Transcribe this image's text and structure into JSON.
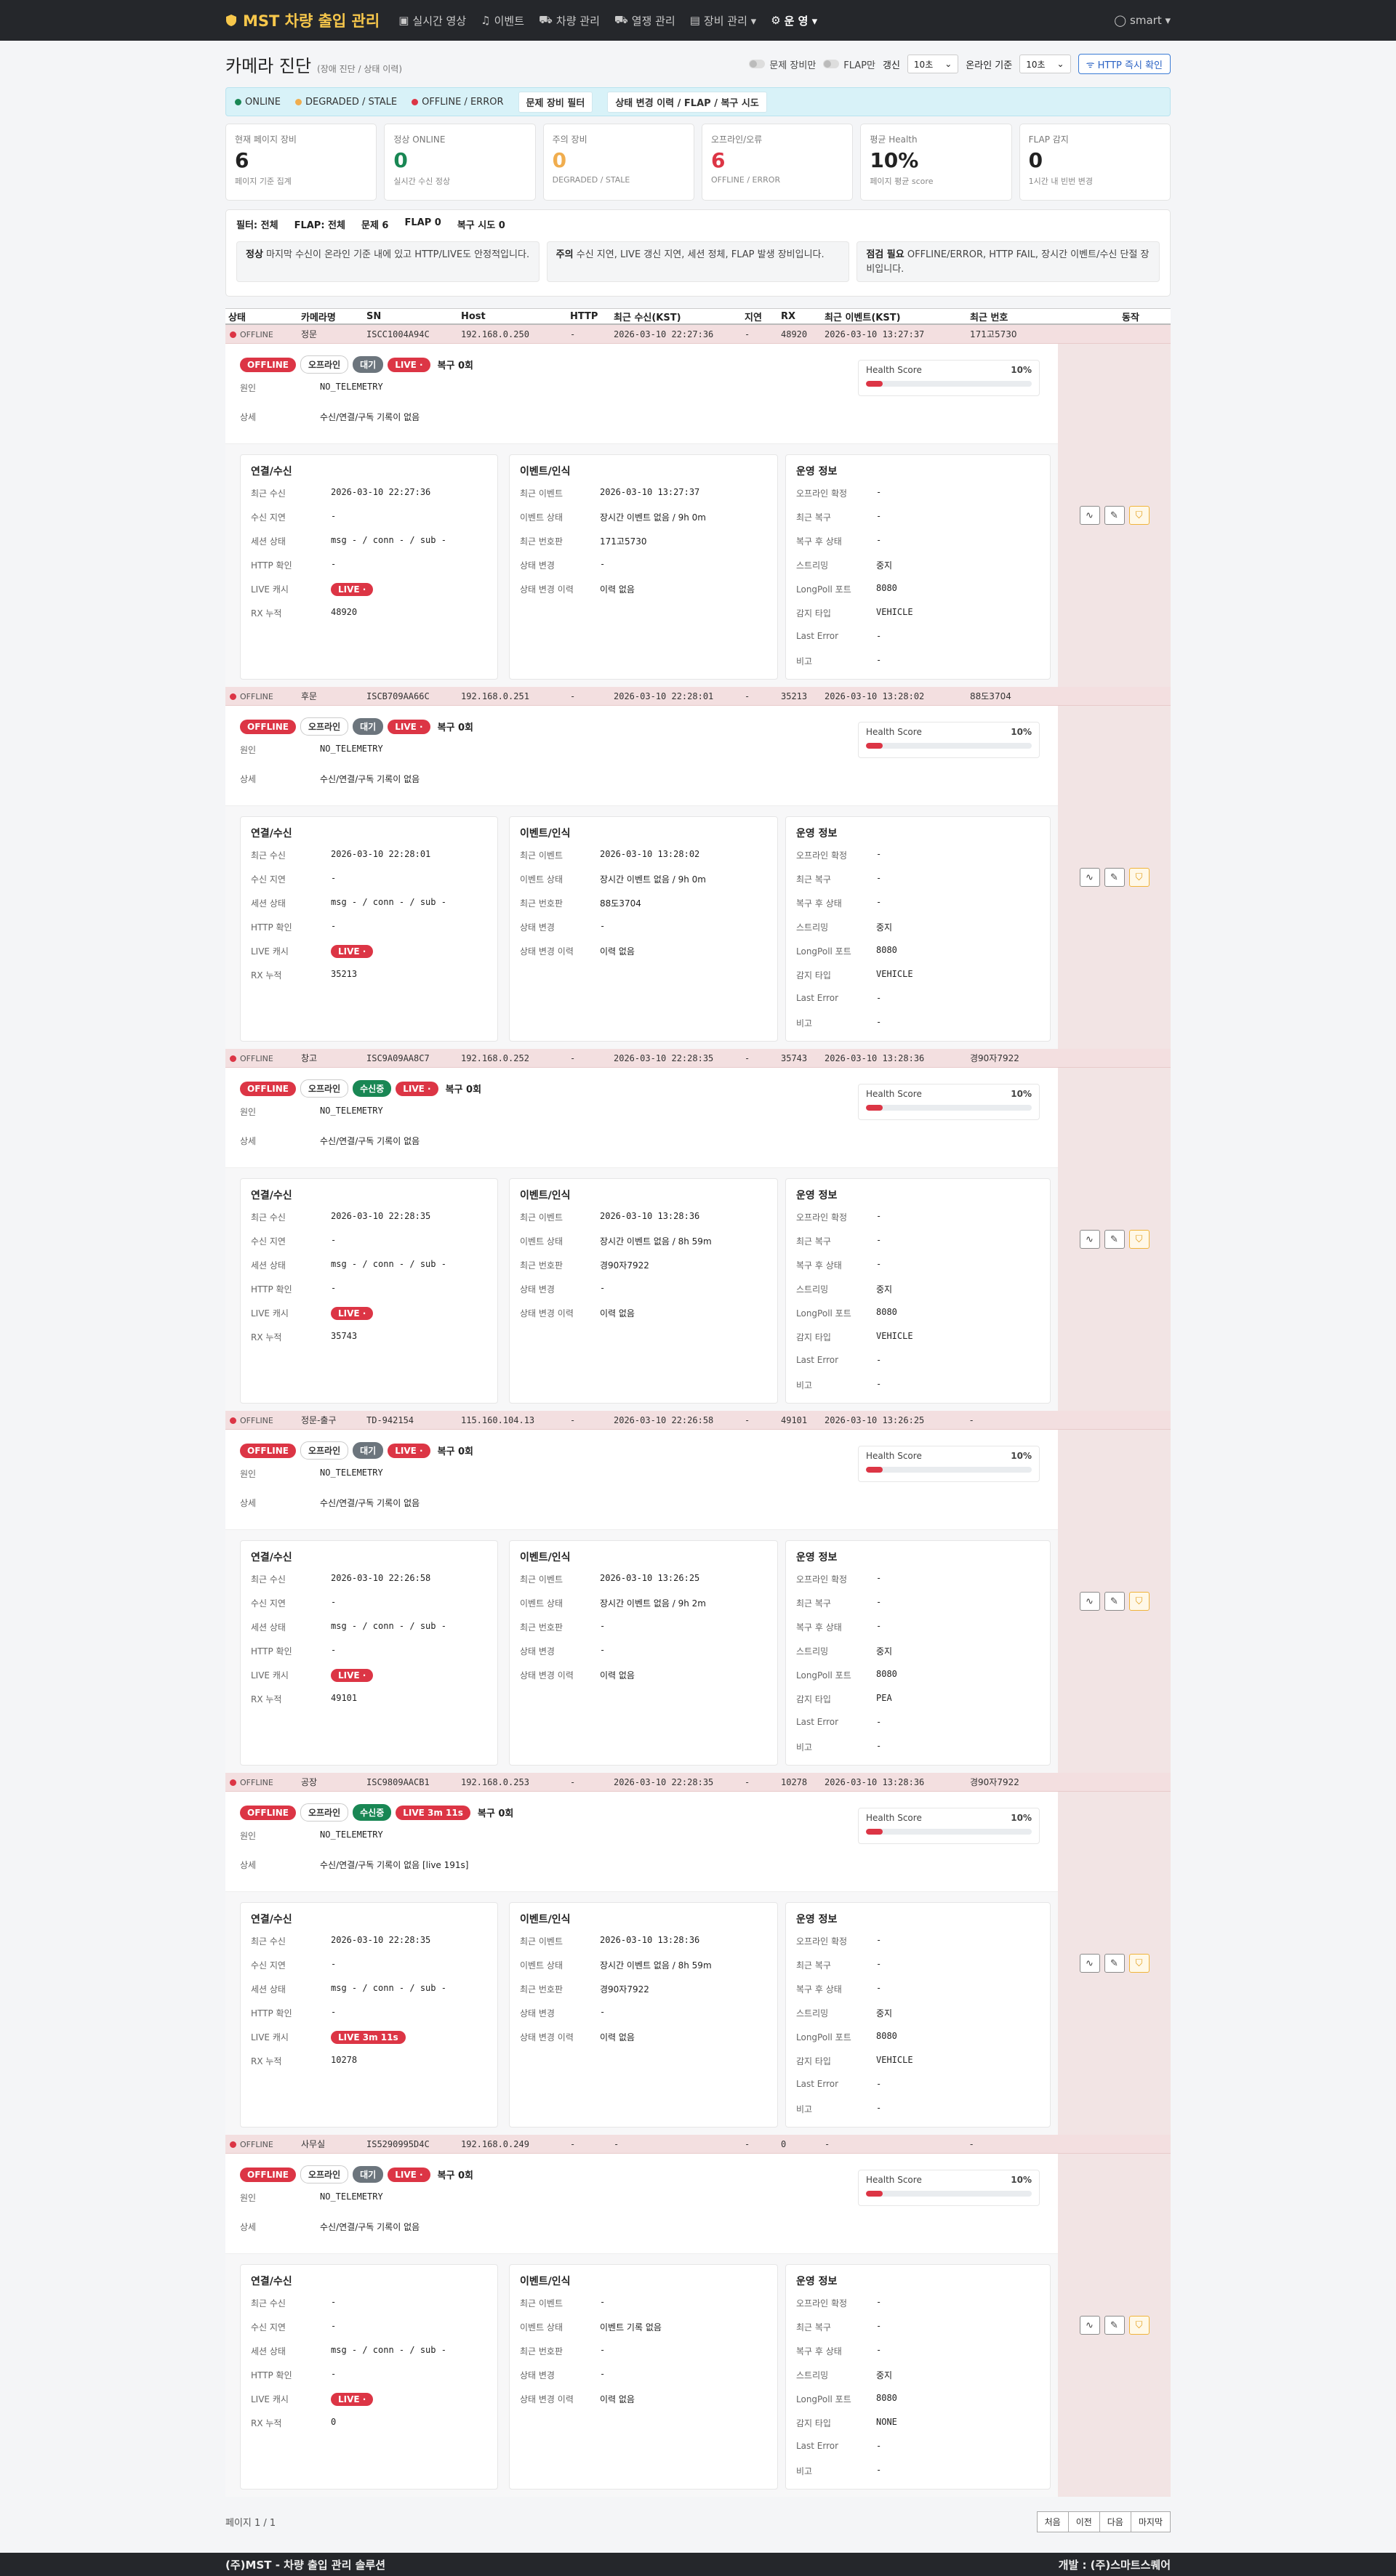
{
  "nav": {
    "brand": "MST 차량 출입 관리",
    "items": [
      "실시간 영상",
      "이벤트",
      "차량 관리",
      "열쟁 관리",
      "장비 관리 ▾",
      "운 영 ▾"
    ],
    "user": "smart ▾"
  },
  "page": {
    "title": "카메라 진단",
    "subtitle": "(장애 진단 / 상태 이력)",
    "toggle_problem": "문제 장비만",
    "toggle_flap": "FLAP만",
    "refresh_label": "갱신",
    "refresh_value": "10초",
    "online_label": "온라인 기준",
    "online_value": "10초",
    "http_button": "HTTP 즉시 확인"
  },
  "legend": {
    "online": "ONLINE",
    "degraded": "DEGRADED / STALE",
    "offline": "OFFLINE / ERROR",
    "btn_filter": "문제 장비 필터",
    "btn_history": "상태 변경 이력 / FLAP / 복구 시도",
    "colors": {
      "online": "#198754",
      "degraded": "#f0ad4e",
      "offline": "#dc3545"
    }
  },
  "cards": [
    {
      "label": "현재 페이지 장비",
      "value": "6",
      "sub": "페이지 기준 집계",
      "color": "#222"
    },
    {
      "label": "정상 ONLINE",
      "value": "0",
      "sub": "실시간 수신 정상",
      "color": "#198754"
    },
    {
      "label": "주의 장비",
      "value": "0",
      "sub": "DEGRADED / STALE",
      "color": "#f0ad4e"
    },
    {
      "label": "오프라인/오류",
      "value": "6",
      "sub": "OFFLINE / ERROR",
      "color": "#dc3545"
    },
    {
      "label": "평균 Health",
      "value": "10%",
      "sub": "페이지 평균 score",
      "color": "#222"
    },
    {
      "label": "FLAP 감지",
      "value": "0",
      "sub": "1시간 내 빈번 변경",
      "color": "#222"
    }
  ],
  "filters": [
    "필터: 전체",
    "FLAP: 전체",
    "문제 6",
    "FLAP 0",
    "복구 시도 0"
  ],
  "hints": [
    {
      "b": "정상",
      "t": "마지막 수신이 온라인 기준 내에 있고 HTTP/LIVE도 안정적입니다."
    },
    {
      "b": "주의",
      "t": "수신 지연, LIVE 갱신 지연, 세션 정체, FLAP 발생 장비입니다."
    },
    {
      "b": "점검 필요",
      "t": "OFFLINE/ERROR, HTTP FAIL, 장시간 이벤트/수신 단절 장비입니다."
    }
  ],
  "table_headers": [
    "상태",
    "카메라명",
    "SN",
    "Host",
    "HTTP",
    "최근 수신(KST)",
    "지연",
    "RX",
    "최근 이벤트(KST)",
    "최근 번호",
    "동작"
  ],
  "labels": {
    "health": "Health Score",
    "cause": "원인",
    "detail": "상세",
    "p1": "연결/수신",
    "p2": "이벤트/인식",
    "p3": "운영 정보",
    "p1k": [
      "최근 수신",
      "수신 지연",
      "세션 상태",
      "HTTP 확인",
      "LIVE 캐시",
      "RX 누적"
    ],
    "p2k": [
      "최근 이벤트",
      "이벤트 상태",
      "최근 번호판",
      "상태 변경",
      "상태 변경 이력"
    ],
    "p3k": [
      "오프라인 확정",
      "최근 복구",
      "복구 후 상태",
      "스트리밍",
      "LongPoll 포트",
      "감지 타입",
      "Last Error",
      "비고"
    ]
  },
  "devices": [
    {
      "status": "OFFLINE",
      "name": "정문",
      "sn": "ISCC1004A94C",
      "host": "192.168.0.250",
      "http": "-",
      "recv": "2026-03-10 22:27:36",
      "delay": "-",
      "rx": "48920",
      "event": "2026-03-10 13:27:37",
      "plate": "171고5730",
      "b2": "대기",
      "b2c": "wait",
      "live": "LIVE ·",
      "recovery": "복구 0회",
      "cause": "NO_TELEMETRY",
      "detail": "수신/연결/구독 기록이 없음",
      "health": "10%",
      "health_pct": 10,
      "p1": [
        "2026-03-10 22:27:36",
        "-",
        "msg - / conn - / sub -",
        "-",
        "LIVE ·",
        "48920"
      ],
      "p2": [
        "2026-03-10 13:27:37",
        "장시간 이벤트 없음 / 9h 0m",
        "171고5730",
        "-",
        "이력 없음"
      ],
      "p3": [
        "-",
        "-",
        "-",
        "중지",
        "8080",
        "VEHICLE",
        "-",
        "-"
      ]
    },
    {
      "status": "OFFLINE",
      "name": "후문",
      "sn": "ISCB709AA66C",
      "host": "192.168.0.251",
      "http": "-",
      "recv": "2026-03-10 22:28:01",
      "delay": "-",
      "rx": "35213",
      "event": "2026-03-10 13:28:02",
      "plate": "88도3704",
      "b2": "대기",
      "b2c": "wait",
      "live": "LIVE ·",
      "recovery": "복구 0회",
      "cause": "NO_TELEMETRY",
      "detail": "수신/연결/구독 기록이 없음",
      "health": "10%",
      "health_pct": 10,
      "p1": [
        "2026-03-10 22:28:01",
        "-",
        "msg - / conn - / sub -",
        "-",
        "LIVE ·",
        "35213"
      ],
      "p2": [
        "2026-03-10 13:28:02",
        "장시간 이벤트 없음 / 9h 0m",
        "88도3704",
        "-",
        "이력 없음"
      ],
      "p3": [
        "-",
        "-",
        "-",
        "중지",
        "8080",
        "VEHICLE",
        "-",
        "-"
      ]
    },
    {
      "status": "OFFLINE",
      "name": "창고",
      "sn": "ISC9A09AA8C7",
      "host": "192.168.0.252",
      "http": "-",
      "recv": "2026-03-10 22:28:35",
      "delay": "-",
      "rx": "35743",
      "event": "2026-03-10 13:28:36",
      "plate": "경90자7922",
      "b2": "수신중",
      "b2c": "recv",
      "live": "LIVE ·",
      "recovery": "복구 0회",
      "cause": "NO_TELEMETRY",
      "detail": "수신/연결/구독 기록이 없음",
      "health": "10%",
      "health_pct": 10,
      "p1": [
        "2026-03-10 22:28:35",
        "-",
        "msg - / conn - / sub -",
        "-",
        "LIVE ·",
        "35743"
      ],
      "p2": [
        "2026-03-10 13:28:36",
        "장시간 이벤트 없음 / 8h 59m",
        "경90자7922",
        "-",
        "이력 없음"
      ],
      "p3": [
        "-",
        "-",
        "-",
        "중지",
        "8080",
        "VEHICLE",
        "-",
        "-"
      ]
    },
    {
      "status": "OFFLINE",
      "name": "정문-출구",
      "sn": "TD-942154",
      "host": "115.160.104.13",
      "http": "-",
      "recv": "2026-03-10 22:26:58",
      "delay": "-",
      "rx": "49101",
      "event": "2026-03-10 13:26:25",
      "plate": "-",
      "b2": "대기",
      "b2c": "wait",
      "live": "LIVE ·",
      "recovery": "복구 0회",
      "cause": "NO_TELEMETRY",
      "detail": "수신/연결/구독 기록이 없음",
      "health": "10%",
      "health_pct": 10,
      "p1": [
        "2026-03-10 22:26:58",
        "-",
        "msg - / conn - / sub -",
        "-",
        "LIVE ·",
        "49101"
      ],
      "p2": [
        "2026-03-10 13:26:25",
        "장시간 이벤트 없음 / 9h 2m",
        "-",
        "-",
        "이력 없음"
      ],
      "p3": [
        "-",
        "-",
        "-",
        "중지",
        "8080",
        "PEA",
        "-",
        "-"
      ]
    },
    {
      "status": "OFFLINE",
      "name": "공장",
      "sn": "ISC9809AACB1",
      "host": "192.168.0.253",
      "http": "-",
      "recv": "2026-03-10 22:28:35",
      "delay": "-",
      "rx": "10278",
      "event": "2026-03-10 13:28:36",
      "plate": "경90자7922",
      "b2": "수신중",
      "b2c": "recv",
      "live": "LIVE 3m 11s",
      "recovery": "복구 0회",
      "cause": "NO_TELEMETRY",
      "detail": "수신/연결/구독 기록이 없음 [live 191s]",
      "health": "10%",
      "health_pct": 10,
      "p1": [
        "2026-03-10 22:28:35",
        "-",
        "msg - / conn - / sub -",
        "-",
        "LIVE 3m 11s",
        "10278"
      ],
      "p2": [
        "2026-03-10 13:28:36",
        "장시간 이벤트 없음 / 8h 59m",
        "경90자7922",
        "-",
        "이력 없음"
      ],
      "p3": [
        "-",
        "-",
        "-",
        "중지",
        "8080",
        "VEHICLE",
        "-",
        "-"
      ]
    },
    {
      "status": "OFFLINE",
      "name": "사무실",
      "sn": "IS5290995D4C",
      "host": "192.168.0.249",
      "http": "-",
      "recv": "-",
      "delay": "-",
      "rx": "0",
      "event": "-",
      "plate": "-",
      "b2": "대기",
      "b2c": "wait",
      "live": "LIVE ·",
      "recovery": "복구 0회",
      "cause": "NO_TELEMETRY",
      "detail": "수신/연결/구독 기록이 없음",
      "health": "10%",
      "health_pct": 10,
      "p1": [
        "-",
        "-",
        "msg - / conn - / sub -",
        "-",
        "LIVE ·",
        "0"
      ],
      "p2": [
        "-",
        "이벤트 기록 없음",
        "-",
        "-",
        "이력 없음"
      ],
      "p3": [
        "-",
        "-",
        "-",
        "중지",
        "8080",
        "NONE",
        "-",
        "-"
      ]
    }
  ],
  "pager": {
    "info": "페이지 1 / 1",
    "buttons": [
      "처음",
      "이전",
      "다음",
      "마지막"
    ]
  },
  "footer": {
    "left": "(주)MST - 차량 출입 관리 솔루션",
    "right": "개발 : (주)스마트스퀘어"
  }
}
